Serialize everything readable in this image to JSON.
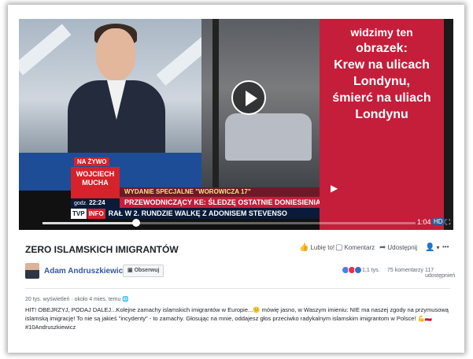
{
  "video": {
    "overlay_lines": [
      "widzimy ten",
      "obrazek:",
      "Krew na ulicach",
      "Londynu,",
      "śmierć na uliach",
      "Londynu"
    ],
    "live_label": "NA ŻYWO",
    "host_first": "WOJCIECH",
    "host_last": "MUCHA",
    "time_prefix": "godz.",
    "time_value": "22:24",
    "ticker_top": "WYDANIE SPECJALNE \"WOROWICZA 17\"",
    "ticker_mid": "PRZEWODNICZĄCY KE: ŚLEDZĘ OSTATNIE DONIESIENIA Z LONDY",
    "ticker_logo": "TVP",
    "ticker_logo2": "INFO",
    "ticker_bottom": "RAŁ W 2. RUNDZIE WALKĘ Z ADONISEM STEVENSO",
    "progress": 0.25,
    "time_elapsed": "1:04",
    "hd_badge": "HD"
  },
  "post": {
    "title": "ZERO ISLAMSKICH IMIGRANTÓW",
    "actions": [
      "Lubię to!",
      "Komentarz",
      "Udostępnij"
    ],
    "author": "Adam Andruszkiewicz",
    "follow_label": "Obserwuj",
    "reaction_count": "1,1 tys.",
    "comments": "75 komentarzy",
    "shares": "117 udostępnień",
    "meta": "20 tys. wyświetleń · około 4 mies. temu",
    "description": "HIT! OBEJRZYJ, PODAJ DALEJ...Kolejne zamachy islamskich imigrantów w Europie...😕 mówię jasno, w Waszym imieniu: NIE ma naszej zgody na przymusową islamską imigrację! To nie są jakieś \"incydenty\" - to zamachy. Głosując na mnie, oddajesz głos przeciwko radykalnym islamskim imigrantom w Polsce! 💪🇵🇱 #10Andruszkiewicz"
  },
  "colors": {
    "facebook_blue": "#365899",
    "tvp_red": "#c41e3a",
    "tvp_navy": "#0a1a38"
  }
}
